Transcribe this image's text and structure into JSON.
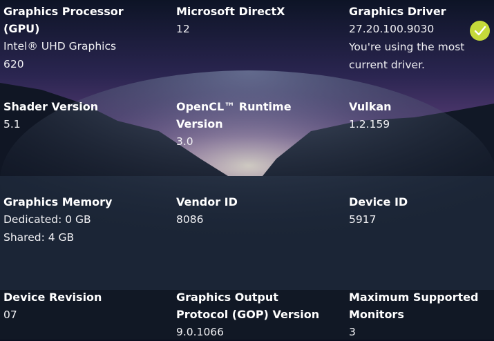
{
  "cells": {
    "gpu": {
      "label_line1": "Graphics Processor",
      "label_line2": "(GPU)",
      "value_line1": "Intel® UHD Graphics",
      "value_line2": "620"
    },
    "directx": {
      "label": "Microsoft DirectX",
      "value": "12"
    },
    "driver": {
      "label": "Graphics Driver",
      "value": "27.20.100.9030",
      "status_line1": "You're using the most",
      "status_line2": "current driver."
    },
    "shader": {
      "label": "Shader Version",
      "value": "5.1"
    },
    "opencl": {
      "label_line1": "OpenCL™ Runtime",
      "label_line2": "Version",
      "value": "3.0"
    },
    "vulkan": {
      "label": "Vulkan",
      "value": "1.2.159"
    },
    "memory": {
      "label": "Graphics Memory",
      "value_line1": "Dedicated: 0 GB",
      "value_line2": "Shared: 4 GB"
    },
    "vendor": {
      "label": "Vendor ID",
      "value": "8086"
    },
    "device": {
      "label": "Device ID",
      "value": "5917"
    },
    "revision": {
      "label": "Device Revision",
      "value": "07"
    },
    "gop": {
      "label_line1": "Graphics Output",
      "label_line2": "Protocol (GOP) Version",
      "value": "9.0.1066"
    },
    "monitors": {
      "label_line1": "Maximum Supported",
      "label_line2": "Monitors",
      "value": "3"
    }
  },
  "colors": {
    "check_accent": "#c5d93a"
  },
  "icons": {
    "driver_status": "checkmark-icon"
  }
}
